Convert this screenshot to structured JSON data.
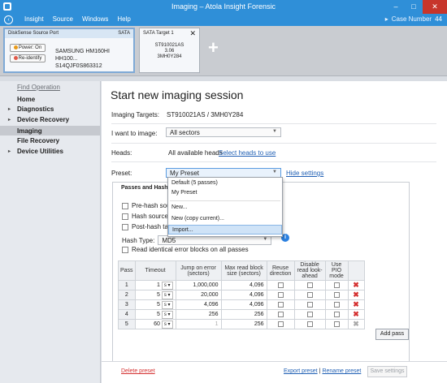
{
  "window": {
    "title": "Imaging – Atola Insight Forensic",
    "controls": {
      "minimize": "–",
      "maximize": "□",
      "close": "✕"
    }
  },
  "menubar": {
    "back_glyph": "‹",
    "items": [
      "Insight",
      "Source",
      "Windows",
      "Help"
    ],
    "case_label": "Case Number",
    "case_number": "44",
    "case_arrow": "▸"
  },
  "source_port": {
    "header": "DiskSense Source Port",
    "interface": "SATA",
    "power_button": "Power: On",
    "reidentify_button": "Re-identify",
    "model": "SAMSUNG HM160HI HH100...",
    "serial": "S14QJF0S863312"
  },
  "target": {
    "label": "SATA Target 1",
    "close_glyph": "✕",
    "line1": "ST910021AS",
    "line2": "3.06",
    "line3": "3MH0Y284",
    "add_glyph": "+"
  },
  "sidebar": {
    "find_operation": "Find Operation",
    "items": [
      {
        "label": "Home",
        "expandable": false
      },
      {
        "label": "Diagnostics",
        "expandable": true
      },
      {
        "label": "Device Recovery",
        "expandable": true
      },
      {
        "label": "Imaging",
        "expandable": false,
        "active": true
      },
      {
        "label": "File Recovery",
        "expandable": false
      },
      {
        "label": "Device Utilities",
        "expandable": true
      }
    ]
  },
  "main": {
    "title": "Start new imaging session",
    "targets_label": "Imaging Targets:",
    "targets_value": "ST910021AS / 3MH0Y284",
    "want_label": "I want to image:",
    "want_value": "All sectors",
    "heads_label": "Heads:",
    "heads_value": "All available heads",
    "heads_link": "Select heads to use",
    "preset_label": "Preset:",
    "preset_value": "My Preset",
    "hide_settings": "Hide settings",
    "combo_arrow": "▼",
    "info_glyph": "i"
  },
  "preset_dropdown": {
    "items": [
      "Default (5 passes)",
      "My Preset",
      "New...",
      "New (copy current)...",
      "Import..."
    ],
    "hovered": "Import..."
  },
  "passes": {
    "tab_label": "Passes and Hash",
    "checks": [
      "Pre-hash sour",
      "Hash source d",
      "Post-hash targ"
    ],
    "hash_type_label": "Hash Type:",
    "hash_type_value": "MD5",
    "read_identical": "Read identical error blocks on all passes",
    "columns": [
      "Pass",
      "Timeout",
      "Jump on error (sectors)",
      "Max read block size (sectors)",
      "Reuse direction",
      "Disable read look-ahead",
      "Use PIO mode",
      ""
    ],
    "rows": [
      {
        "pass": "1",
        "timeout": "1",
        "unit": "s",
        "jump": "1,000,000",
        "max_block": "4,096",
        "delete": "✖"
      },
      {
        "pass": "2",
        "timeout": "5",
        "unit": "s",
        "jump": "20,000",
        "max_block": "4,096",
        "delete": "✖"
      },
      {
        "pass": "3",
        "timeout": "5",
        "unit": "s",
        "jump": "4,096",
        "max_block": "4,096",
        "delete": "✖"
      },
      {
        "pass": "4",
        "timeout": "5",
        "unit": "s",
        "jump": "256",
        "max_block": "256",
        "delete": "✖"
      },
      {
        "pass": "5",
        "timeout": "60",
        "unit": "s",
        "jump": "1",
        "max_block": "256",
        "delete": "✖"
      }
    ],
    "add_pass": "Add pass"
  },
  "footer": {
    "delete_preset": "Delete preset",
    "export_preset": "Export preset",
    "divider": "|",
    "rename_preset": "Rename preset",
    "save_settings": "Save settings"
  },
  "colors": {
    "titlebar": "#2f8fd8",
    "link": "#1f5fb4",
    "delete": "#d43030",
    "info": "#2b80e0"
  }
}
